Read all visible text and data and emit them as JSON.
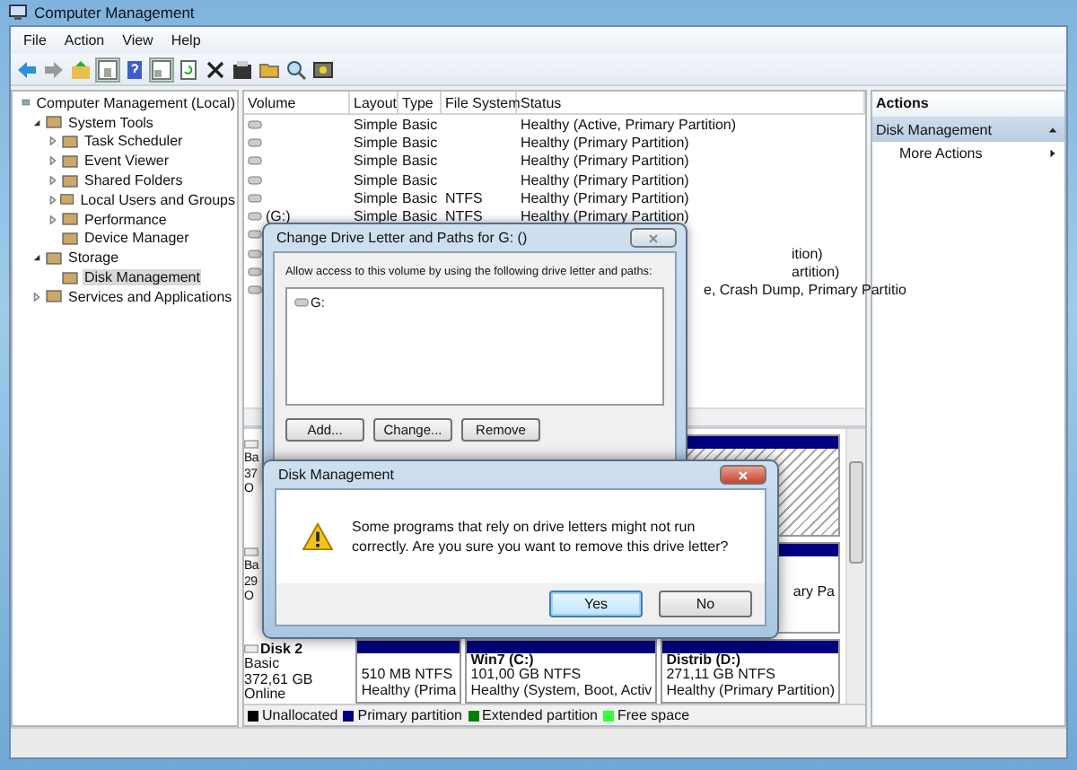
{
  "window": {
    "title": "Computer Management"
  },
  "menu": [
    "File",
    "Action",
    "View",
    "Help"
  ],
  "tree": [
    {
      "label": "Computer Management (Local)",
      "selected": false,
      "children": [
        {
          "label": "System Tools",
          "expanded": true,
          "selected": false,
          "children": [
            {
              "label": "Task Scheduler",
              "expanded": false,
              "selected": false
            },
            {
              "label": "Event Viewer",
              "expanded": false,
              "selected": false
            },
            {
              "label": "Shared Folders",
              "expanded": false,
              "selected": false
            },
            {
              "label": "Local Users and Groups",
              "expanded": false,
              "selected": false
            },
            {
              "label": "Performance",
              "expanded": false,
              "selected": false
            },
            {
              "label": "Device Manager",
              "selected": false
            }
          ]
        },
        {
          "label": "Storage",
          "expanded": true,
          "selected": false,
          "children": [
            {
              "label": "Disk Management",
              "selected": true
            }
          ]
        },
        {
          "label": "Services and Applications",
          "expanded": false,
          "selected": false
        }
      ]
    }
  ],
  "table": {
    "columns": [
      "Volume",
      "Layout",
      "Type",
      "File System",
      "Status"
    ],
    "rows": [
      {
        "kind": "full",
        "volume": "",
        "layout": "Simple",
        "type": "Basic",
        "fs": "",
        "status": "Healthy (Active, Primary Partition)"
      },
      {
        "kind": "full",
        "volume": "",
        "layout": "Simple",
        "type": "Basic",
        "fs": "",
        "status": "Healthy (Primary Partition)"
      },
      {
        "kind": "full",
        "volume": "",
        "layout": "Simple",
        "type": "Basic",
        "fs": "",
        "status": "Healthy (Primary Partition)"
      },
      {
        "kind": "full",
        "volume": "",
        "layout": "Simple",
        "type": "Basic",
        "fs": "",
        "status": "Healthy (Primary Partition)"
      },
      {
        "kind": "full",
        "volume": "",
        "layout": "Simple",
        "type": "Basic",
        "fs": "NTFS",
        "status": "Healthy (Primary Partition)"
      },
      {
        "kind": "full",
        "volume": "(G:)",
        "layout": "Simple",
        "type": "Basic",
        "fs": "NTFS",
        "status": "Healthy (Primary Partition)"
      },
      {
        "kind": "partial",
        "status": ""
      },
      {
        "kind": "partial",
        "status": "ition)"
      },
      {
        "kind": "partial",
        "status": "artition)"
      },
      {
        "kind": "partial",
        "status": "e, Crash Dump, Primary Partitio"
      }
    ]
  },
  "disks": [
    {
      "lines": [
        "Ba",
        "37",
        "O"
      ],
      "partitions": [
        {
          "selected": true
        }
      ]
    },
    {
      "lines": [
        "Ba",
        "29",
        "O"
      ],
      "partitions": [
        {
          "selected": false,
          "lines": [
            "ary Pa"
          ]
        }
      ]
    },
    {
      "lines": [
        "Basic",
        "372,61 GB",
        "Online"
      ],
      "title": "Disk 2",
      "partitions": [
        {
          "selected": false,
          "lines": [
            "510 MB NTFS",
            "Healthy (Prima"
          ]
        },
        {
          "selected": false,
          "name": "Win7  (C:)",
          "lines": [
            "101,00 GB NTFS",
            "Healthy (System, Boot, Activ"
          ]
        },
        {
          "selected": false,
          "name": "Distrib  (D:)",
          "lines": [
            "271,11 GB NTFS",
            "Healthy (Primary Partition)"
          ]
        }
      ]
    }
  ],
  "legend": [
    {
      "label": "Unallocated",
      "color": "#000000"
    },
    {
      "label": "Primary partition",
      "color": "#000080"
    },
    {
      "label": "Extended partition",
      "color": "#008000"
    },
    {
      "label": "Free space",
      "color": "#33ff33"
    }
  ],
  "actions": {
    "title": "Actions",
    "section": "Disk Management",
    "items": [
      "More Actions"
    ]
  },
  "change_dialog": {
    "title": "Change Drive Letter and Paths for G: ()",
    "prompt": "Allow access to this volume by using the following drive letter and paths:",
    "paths": [
      "G:"
    ],
    "buttons": [
      "Add...",
      "Change...",
      "Remove"
    ]
  },
  "confirm_dialog": {
    "title": "Disk Management",
    "message": "Some programs that rely on drive letters might not run correctly. Are you sure you want to remove this drive letter?",
    "buttons": [
      {
        "label": "Yes",
        "selected": true
      },
      {
        "label": "No",
        "selected": false
      }
    ]
  }
}
